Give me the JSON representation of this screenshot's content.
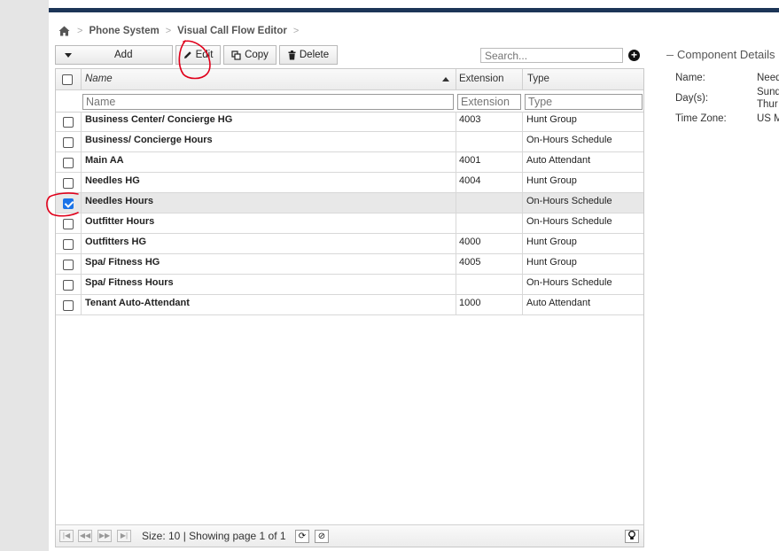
{
  "breadcrumb": {
    "items": [
      "Phone System",
      "Visual Call Flow Editor"
    ]
  },
  "toolbar": {
    "add_label": "Add",
    "edit_label": "Edit",
    "copy_label": "Copy",
    "delete_label": "Delete"
  },
  "search": {
    "placeholder": "Search..."
  },
  "grid": {
    "columns": {
      "name": "Name",
      "extension": "Extension",
      "type": "Type"
    },
    "filters": {
      "name": "Name",
      "extension": "Extension",
      "type": "Type"
    },
    "rows": [
      {
        "name": "Business Center/ Concierge HG",
        "extension": "4003",
        "type": "Hunt Group",
        "checked": false
      },
      {
        "name": "Business/ Concierge Hours",
        "extension": "",
        "type": "On-Hours Schedule",
        "checked": false
      },
      {
        "name": "Main AA",
        "extension": "4001",
        "type": "Auto Attendant",
        "checked": false
      },
      {
        "name": "Needles HG",
        "extension": "4004",
        "type": "Hunt Group",
        "checked": false
      },
      {
        "name": "Needles Hours",
        "extension": "",
        "type": "On-Hours Schedule",
        "checked": true
      },
      {
        "name": "Outfitter Hours",
        "extension": "",
        "type": "On-Hours Schedule",
        "checked": false
      },
      {
        "name": "Outfitters HG",
        "extension": "4000",
        "type": "Hunt Group",
        "checked": false
      },
      {
        "name": "Spa/ Fitness HG",
        "extension": "4005",
        "type": "Hunt Group",
        "checked": false
      },
      {
        "name": "Spa/ Fitness Hours",
        "extension": "",
        "type": "On-Hours Schedule",
        "checked": false
      },
      {
        "name": "Tenant Auto-Attendant",
        "extension": "1000",
        "type": "Auto Attendant",
        "checked": false
      }
    ],
    "footer": {
      "status": "Size: 10 | Showing page 1 of 1"
    }
  },
  "details": {
    "title": "Component Details",
    "fields": [
      {
        "label": "Name:",
        "value": "Need"
      },
      {
        "label": "Day(s):",
        "value": "Sund",
        "value2": "Thur"
      },
      {
        "label": "Time Zone:",
        "value": "US M"
      }
    ]
  },
  "colors": {
    "top_bar": "#1c3557",
    "checkbox_checked": "#1a73e8",
    "annotation": "#e0001b"
  }
}
